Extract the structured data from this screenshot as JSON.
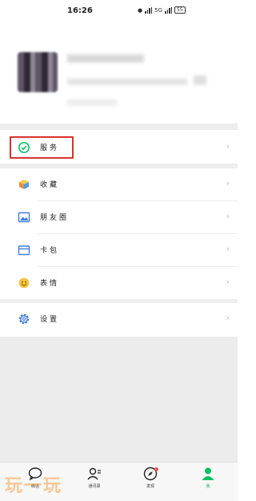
{
  "status_bar": {
    "time": "16:26",
    "network": "5G",
    "battery": "55"
  },
  "menu": {
    "items": [
      {
        "label": "服务",
        "icon": "service-icon"
      },
      {
        "label": "收藏",
        "icon": "favorites-cube-icon"
      },
      {
        "label": "朋友圈",
        "icon": "moments-image-icon"
      },
      {
        "label": "卡包",
        "icon": "card-wallet-icon"
      },
      {
        "label": "表情",
        "icon": "sticker-smile-icon"
      },
      {
        "label": "设置",
        "icon": "settings-gear-icon"
      }
    ]
  },
  "tabs": [
    {
      "label": "微信",
      "icon": "chat-bubble-icon"
    },
    {
      "label": "通讯录",
      "icon": "contacts-icon"
    },
    {
      "label": "发现",
      "icon": "discover-compass-icon"
    },
    {
      "label": "我",
      "icon": "me-person-icon"
    }
  ],
  "watermark": "玩一玩",
  "colors": {
    "accent_green": "#07c160",
    "highlight_red": "#d9302d",
    "background_gray": "#ededed"
  }
}
